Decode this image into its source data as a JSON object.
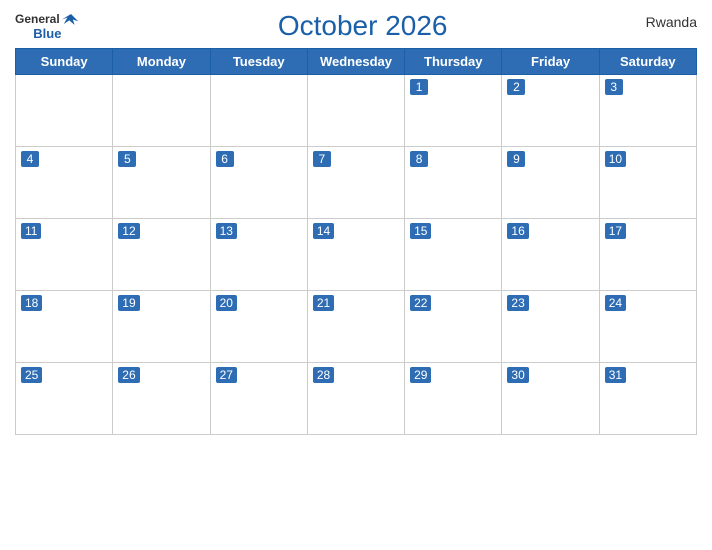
{
  "header": {
    "logo": {
      "general": "General",
      "blue": "Blue"
    },
    "title": "October 2026",
    "country": "Rwanda"
  },
  "weekdays": [
    "Sunday",
    "Monday",
    "Tuesday",
    "Wednesday",
    "Thursday",
    "Friday",
    "Saturday"
  ],
  "weeks": [
    [
      null,
      null,
      null,
      null,
      1,
      2,
      3
    ],
    [
      4,
      5,
      6,
      7,
      8,
      9,
      10
    ],
    [
      11,
      12,
      13,
      14,
      15,
      16,
      17
    ],
    [
      18,
      19,
      20,
      21,
      22,
      23,
      24
    ],
    [
      25,
      26,
      27,
      28,
      29,
      30,
      31
    ]
  ]
}
